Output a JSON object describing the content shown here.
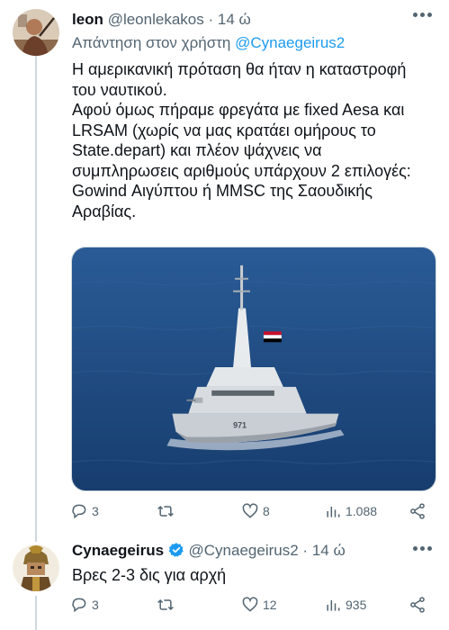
{
  "tweets": [
    {
      "author_name": "leon",
      "author_handle": "@leonlekakos",
      "separator": "·",
      "time": "14 ώ",
      "reply_prefix": "Απάντηση στον χρήστη",
      "reply_mention": "@Cynaegeirus2",
      "text": "Η αμερικανική πρόταση θα ήταν η καταστροφή\nτου ναυτικού.\nΑφού όμως πήραμε φρεγάτα με fixed Aesa και\nLRSAM (χωρίς να μας κρατάει ομήρους το\nState.depart) και πλέον ψάχνεις να\nσυμπληρωσεις αριθμούς υπάρχουν 2 επιλογές:\nGowind Αιγύπτου ή MMSC της Σαουδικής\nΑραβίας.",
      "media": {
        "hull_number": "971"
      },
      "stats": {
        "replies": "3",
        "reposts": "",
        "likes": "8",
        "views": "1.088"
      }
    },
    {
      "author_name": "Cynaegeirus",
      "author_handle": "@Cynaegeirus2",
      "separator": "·",
      "time": "14 ώ",
      "verified": true,
      "text": "Βρες 2-3 δις για αρχή",
      "stats": {
        "replies": "3",
        "reposts": "",
        "likes": "12",
        "views": "935"
      }
    }
  ],
  "icons": {
    "reply": "reply-icon",
    "repost": "repost-icon",
    "like": "heart-icon",
    "views": "views-icon",
    "share": "share-icon",
    "more": "more-icon",
    "verified": "verified-badge-icon"
  },
  "colors": {
    "link": "#1d9bf0",
    "secondary_text": "#536471",
    "primary_text": "#0f1419",
    "sea": "#1f4d86",
    "thread_line": "#cfd9de"
  }
}
